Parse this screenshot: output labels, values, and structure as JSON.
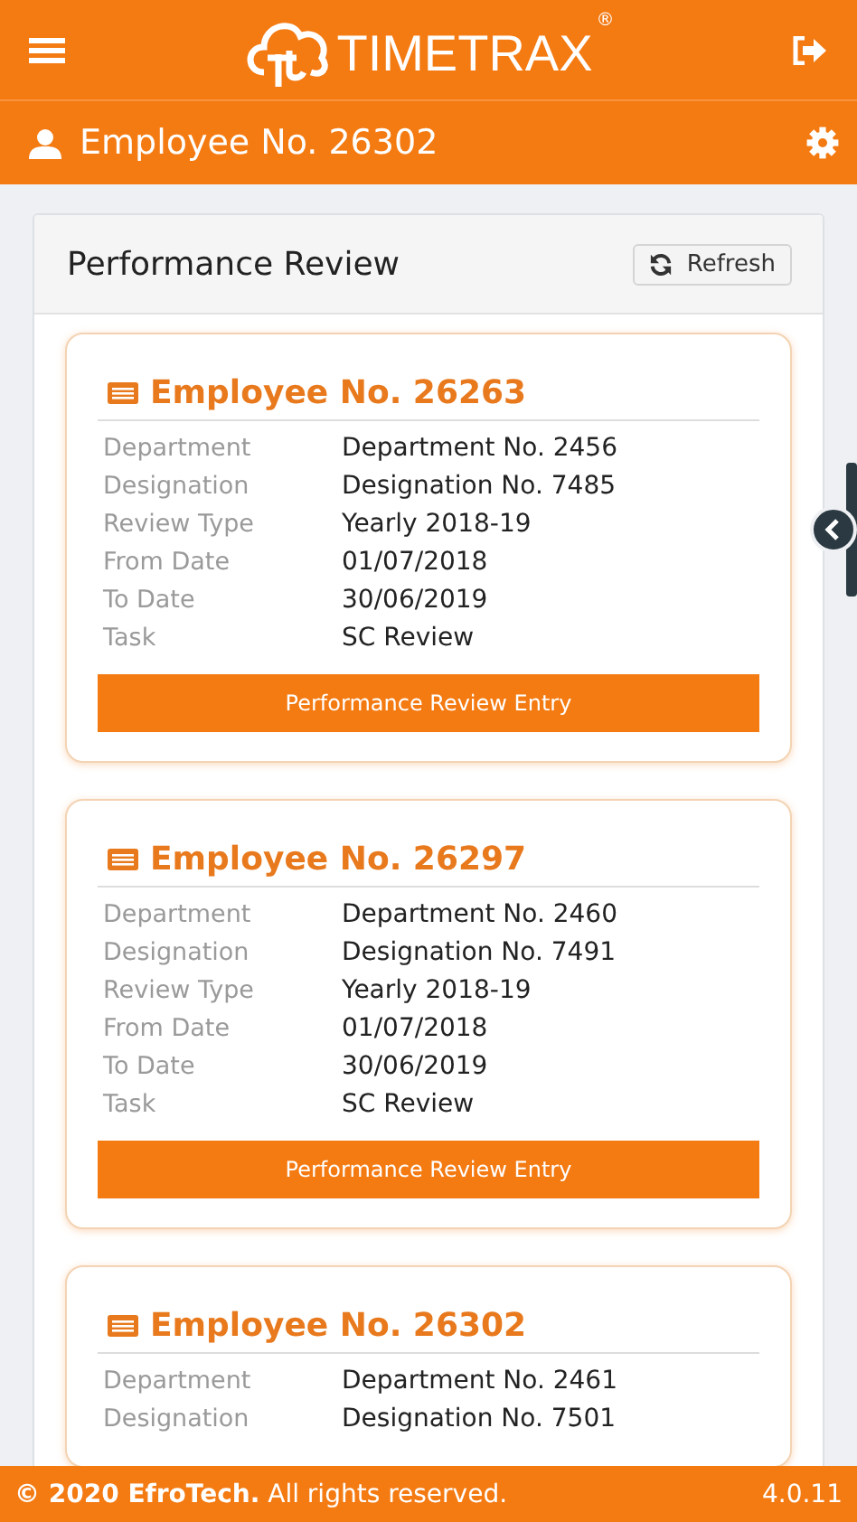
{
  "header": {
    "logo_text": "TIMETRAX",
    "logo_mark": "®"
  },
  "subheader": {
    "title": "Employee No. 26302"
  },
  "panel": {
    "title": "Performance Review",
    "refresh_label": "Refresh"
  },
  "cards": [
    {
      "title": "Employee No. 26263",
      "fields": [
        {
          "label": "Department",
          "value": "Department No. 2456"
        },
        {
          "label": "Designation",
          "value": "Designation No. 7485"
        },
        {
          "label": "Review Type",
          "value": "Yearly 2018-19"
        },
        {
          "label": "From Date",
          "value": "01/07/2018"
        },
        {
          "label": "To Date",
          "value": "30/06/2019"
        },
        {
          "label": "Task",
          "value": "SC Review"
        }
      ],
      "button": "Performance Review Entry"
    },
    {
      "title": "Employee No. 26297",
      "fields": [
        {
          "label": "Department",
          "value": "Department No. 2460"
        },
        {
          "label": "Designation",
          "value": "Designation No. 7491"
        },
        {
          "label": "Review Type",
          "value": "Yearly 2018-19"
        },
        {
          "label": "From Date",
          "value": "01/07/2018"
        },
        {
          "label": "To Date",
          "value": "30/06/2019"
        },
        {
          "label": "Task",
          "value": "SC Review"
        }
      ],
      "button": "Performance Review Entry"
    },
    {
      "title": "Employee No. 26302",
      "fields": [
        {
          "label": "Department",
          "value": "Department No. 2461"
        },
        {
          "label": "Designation",
          "value": "Designation No. 7501"
        }
      ]
    }
  ],
  "footer": {
    "copyright": "**© 2020 EfroTech.** All rights reserved.",
    "version": "4.0.11"
  }
}
